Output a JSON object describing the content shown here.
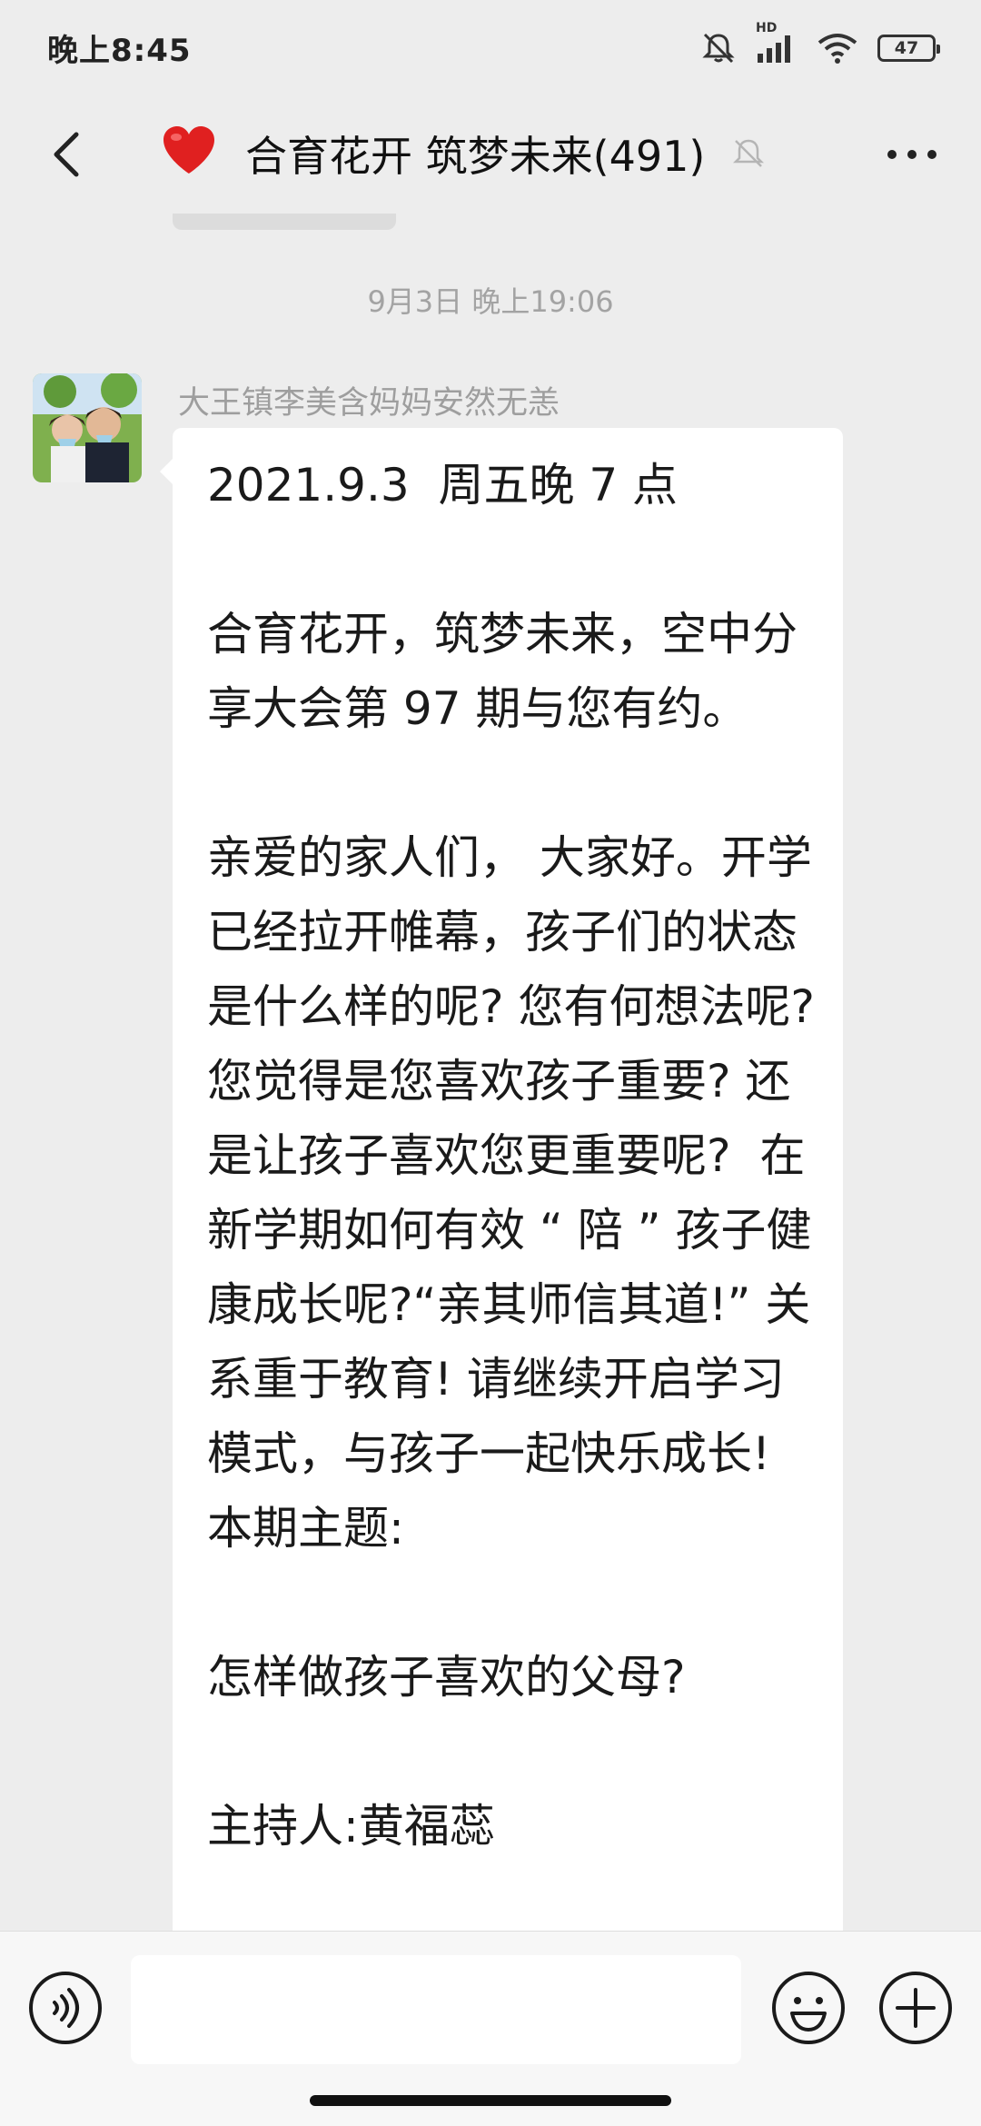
{
  "status_bar": {
    "time": "晚上8:45",
    "network_label": "HD",
    "battery_level": "47"
  },
  "header": {
    "title": "合育花开 筑梦未来(491)",
    "heart_emoji": "❤️"
  },
  "chat": {
    "timestamp": "9月3日 晚上19:06",
    "message": {
      "sender": "大王镇李美含妈妈安然无恙",
      "text": "2021.9.3  周五晚 7 点\n\n合育花开，筑梦未来，空中分享大会第 97 期与您有约。\n\n亲爱的家人们， 大家好。开学已经拉开帷幕，孩子们的状态是什么样的呢? 您有何想法呢? 您觉得是您喜欢孩子重要? 还是让孩子喜欢您更重要呢?  在新学期如何有效 “ 陪 ” 孩子健康成长呢?“亲其师信其道!” 关系重于教育! 请继续开启学习模式，与孩子一起快乐成长!\n本期主题:\n\n怎样做孩子喜欢的父母?\n\n主持人:黄福蕊"
    }
  },
  "input": {
    "placeholder": ""
  },
  "colors": {
    "background": "#ededed",
    "bubble": "#ffffff",
    "heart": "#e02020"
  }
}
